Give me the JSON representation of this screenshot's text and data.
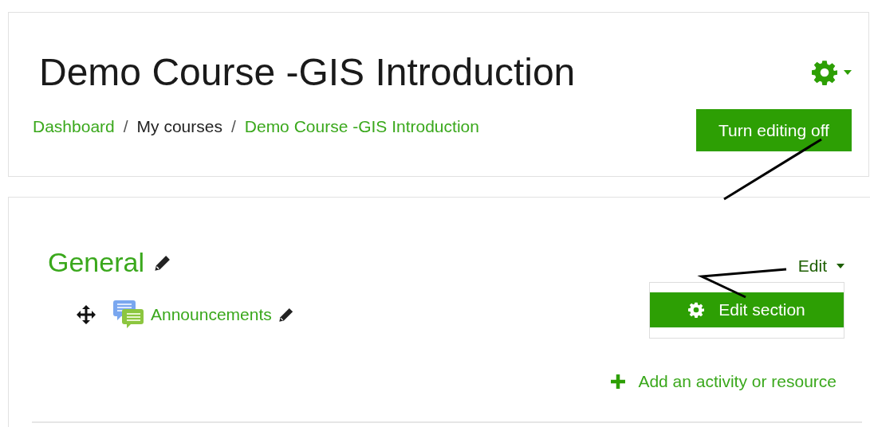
{
  "course_title": "Demo Course -GIS Introduction",
  "breadcrumb": [
    {
      "label": "Dashboard",
      "kind": "link"
    },
    {
      "label": "My courses",
      "kind": "text"
    },
    {
      "label": "Demo Course -GIS Introduction",
      "kind": "link"
    }
  ],
  "breadcrumb_separators": [
    "/",
    "/"
  ],
  "edit_mode_button": "Turn editing off",
  "section": {
    "title": "General",
    "edit_menu": {
      "label": "Edit",
      "expanded": true,
      "items": [
        {
          "label": "Edit section",
          "selected": true
        }
      ]
    },
    "activities": [
      {
        "name": "Announcements"
      }
    ],
    "add_activity": "Add an activity or resource"
  }
}
